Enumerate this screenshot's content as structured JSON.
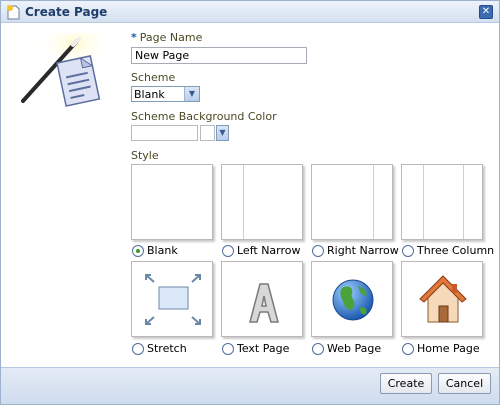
{
  "dialog": {
    "title": "Create Page",
    "close_icon": "close-icon"
  },
  "form": {
    "page_name_required_marker": "*",
    "page_name_label": "Page Name",
    "page_name_value": "New Page",
    "scheme_label": "Scheme",
    "scheme_value": "Blank",
    "scheme_bg_label": "Scheme Background Color",
    "scheme_bg_value": "",
    "style_label": "Style"
  },
  "styles": [
    {
      "label": "Blank",
      "selected": true,
      "icon": "blank-layout"
    },
    {
      "label": "Left Narrow",
      "selected": false,
      "icon": "left-narrow-layout"
    },
    {
      "label": "Right Narrow",
      "selected": false,
      "icon": "right-narrow-layout"
    },
    {
      "label": "Three Column",
      "selected": false,
      "icon": "three-column-layout"
    },
    {
      "label": "Stretch",
      "selected": false,
      "icon": "stretch-icon"
    },
    {
      "label": "Text Page",
      "selected": false,
      "icon": "letter-a-icon"
    },
    {
      "label": "Web Page",
      "selected": false,
      "icon": "globe-icon"
    },
    {
      "label": "Home Page",
      "selected": false,
      "icon": "house-icon"
    }
  ],
  "buttons": {
    "create": "Create",
    "cancel": "Cancel"
  },
  "colors": {
    "title_text": "#1f3d6b",
    "label_text": "#4a4a24",
    "selected_radio": "#3c9a2c"
  }
}
